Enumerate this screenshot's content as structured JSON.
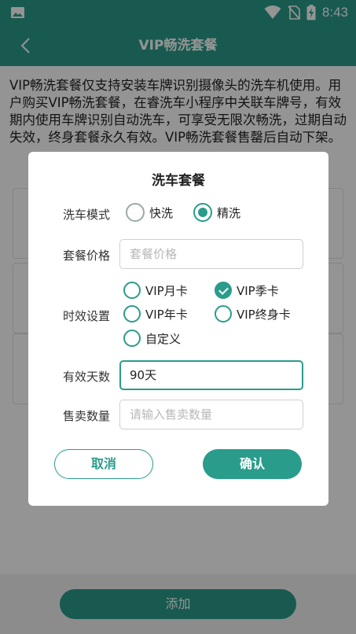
{
  "status_bar": {
    "time": "8:43",
    "icons": [
      "image-icon",
      "wifi-icon",
      "sim-off-icon",
      "battery-charging-icon"
    ]
  },
  "app_bar": {
    "title": "VIP畅洗套餐",
    "back_icon": "back-arrow-icon"
  },
  "description": "VIP畅洗套餐仅支持安装车牌识别摄像头的洗车机使用。用户购买VIP畅洗套餐，在睿洗车小程序中关联车牌号，有效期内使用车牌识别自动洗车，可享受无限次畅洗，过期自动失效，终身套餐永久有效。VIP畅洗套餐售罄后自动下架。",
  "add_button": "添加",
  "dialog": {
    "title": "洗车套餐",
    "wash_mode": {
      "label": "洗车模式",
      "options": [
        {
          "label": "快洗",
          "selected": false
        },
        {
          "label": "精洗",
          "selected": true
        }
      ]
    },
    "price": {
      "label": "套餐价格",
      "placeholder": "套餐价格",
      "value": ""
    },
    "validity": {
      "label": "时效设置",
      "options": [
        {
          "label": "VIP月卡",
          "checked": false
        },
        {
          "label": "VIP季卡",
          "checked": true
        },
        {
          "label": "VIP年卡",
          "checked": false
        },
        {
          "label": "VIP终身卡",
          "checked": false
        },
        {
          "label": "自定义",
          "checked": false
        }
      ]
    },
    "valid_days": {
      "label": "有效天数",
      "value": "90天"
    },
    "sales_qty": {
      "label": "售卖数量",
      "placeholder": "请输入售卖数量",
      "value": ""
    },
    "cancel_label": "取消",
    "confirm_label": "确认"
  },
  "colors": {
    "accent": "#2a9c8b",
    "overlay": "rgba(0,0,0,0.42)"
  }
}
